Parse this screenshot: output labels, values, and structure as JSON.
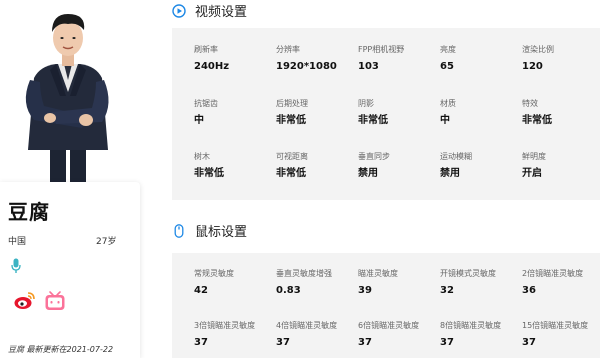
{
  "profile": {
    "name": "豆腐",
    "country": "中国",
    "age": "27岁",
    "updated": "豆腐 最新更新在2021-07-22"
  },
  "video": {
    "title": "视频设置",
    "rows": [
      [
        {
          "label": "刷新率",
          "value": "240Hz"
        },
        {
          "label": "分辨率",
          "value": "1920*1080"
        },
        {
          "label": "FPP相机视野",
          "value": "103"
        },
        {
          "label": "亮度",
          "value": "65"
        },
        {
          "label": "渲染比例",
          "value": "120"
        }
      ],
      [
        {
          "label": "抗锯齿",
          "value": "中"
        },
        {
          "label": "后期处理",
          "value": "非常低"
        },
        {
          "label": "阴影",
          "value": "非常低"
        },
        {
          "label": "材质",
          "value": "中"
        },
        {
          "label": "特效",
          "value": "非常低"
        }
      ],
      [
        {
          "label": "树木",
          "value": "非常低"
        },
        {
          "label": "可视距离",
          "value": "非常低"
        },
        {
          "label": "垂直同步",
          "value": "禁用"
        },
        {
          "label": "运动模糊",
          "value": "禁用"
        },
        {
          "label": "鲜明度",
          "value": "开启"
        }
      ]
    ]
  },
  "mouse": {
    "title": "鼠标设置",
    "rows": [
      [
        {
          "label": "常规灵敏度",
          "value": "42"
        },
        {
          "label": "垂直灵敏度增强",
          "value": "0.83"
        },
        {
          "label": "瞄准灵敏度",
          "value": "39"
        },
        {
          "label": "开镜模式灵敏度",
          "value": "32"
        },
        {
          "label": "2倍镜瞄准灵敏度",
          "value": "36"
        }
      ],
      [
        {
          "label": "3倍镜瞄准灵敏度",
          "value": "37"
        },
        {
          "label": "4倍镜瞄准灵敏度",
          "value": "37"
        },
        {
          "label": "6倍镜瞄准灵敏度",
          "value": "37"
        },
        {
          "label": "8倍镜瞄准灵敏度",
          "value": "37"
        },
        {
          "label": "15倍镜瞄准灵敏度",
          "value": "37"
        }
      ]
    ]
  },
  "colors": {
    "accent": "#1e88e5",
    "weibo": "#e6162d",
    "bilibili": "#fb7299",
    "mic": "#3bb3c3",
    "panel_bg": "#f3f3f3"
  },
  "icons": {
    "video": "play-circle-icon",
    "mouse": "mouse-icon",
    "mic": "microphone-icon",
    "weibo": "weibo-icon",
    "bilibili": "bilibili-icon"
  }
}
